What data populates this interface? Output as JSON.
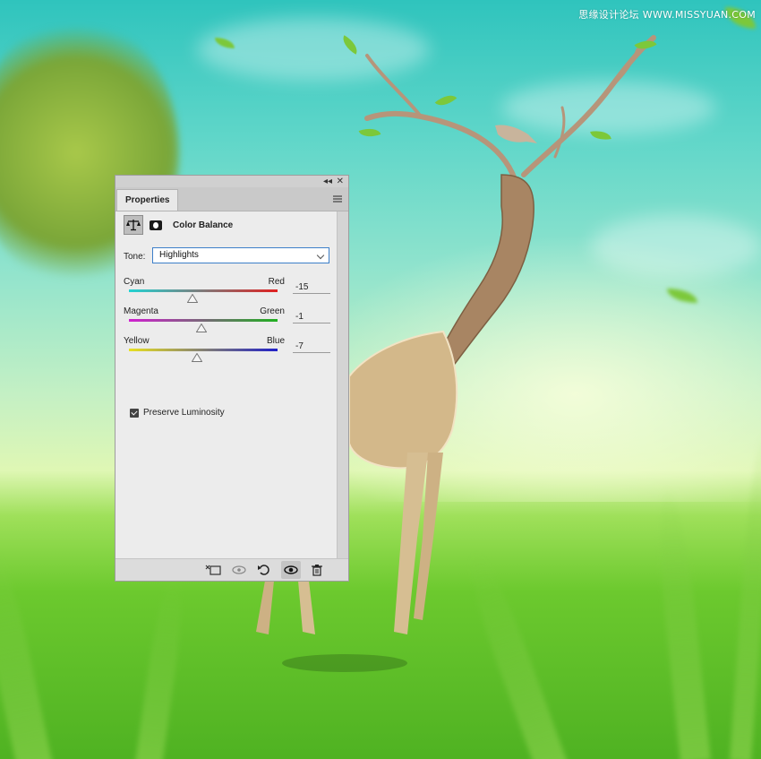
{
  "watermark": "思缘设计论坛 WWW.MISSYUAN.COM",
  "panel": {
    "tab_label": "Properties",
    "collapse_icon": "double-chevron-icon",
    "close_icon": "close-icon",
    "adjustment_title": "Color Balance",
    "tone": {
      "label": "Tone:",
      "selected": "Highlights"
    },
    "sliders": [
      {
        "left_label": "Cyan",
        "right_label": "Red",
        "value": "-15",
        "position_fraction": 0.43,
        "left_color": "#22d3d3",
        "right_color": "#e02020"
      },
      {
        "left_label": "Magenta",
        "right_label": "Green",
        "value": "-1",
        "position_fraction": 0.49,
        "left_color": "#d020d0",
        "right_color": "#20b020"
      },
      {
        "left_label": "Yellow",
        "right_label": "Blue",
        "value": "-7",
        "position_fraction": 0.46,
        "left_color": "#e8e020",
        "right_color": "#2020c8"
      }
    ],
    "preserve_luminosity": {
      "label": "Preserve Luminosity",
      "checked": true
    },
    "footer_icons": [
      "clip-to-layer-icon",
      "view-previous-icon",
      "reset-icon",
      "visibility-eye-icon",
      "trash-icon"
    ]
  }
}
